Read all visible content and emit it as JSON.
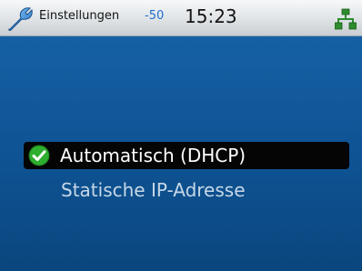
{
  "status_bar": {
    "app_icon": "wrench-icon",
    "title": "Einstellungen",
    "signal": "-50",
    "time": "15:23",
    "network_icon": "network-icon"
  },
  "menu": {
    "items": [
      {
        "label": "Automatisch (DHCP)",
        "selected": true,
        "icon": "check-icon"
      },
      {
        "label": "Statische IP-Adresse",
        "selected": false
      }
    ]
  },
  "colors": {
    "background_top": "#1560a4",
    "background_bottom": "#0a467e",
    "selection": "#050505",
    "check_green": "#2fae2f",
    "signal_blue": "#1e6fd0",
    "network_green": "#2e8b2e"
  }
}
